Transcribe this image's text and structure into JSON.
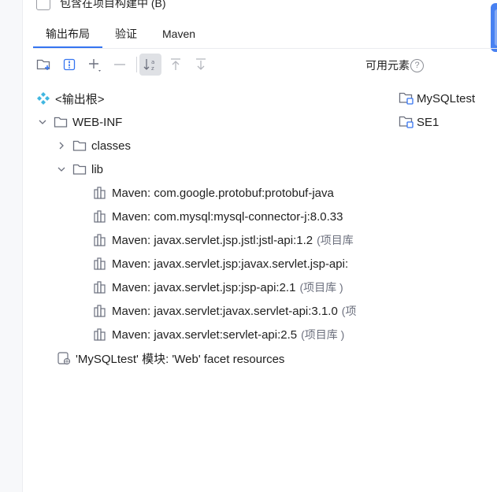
{
  "checkbox": {
    "label": "包含在项目构建中 (B)",
    "checked": false
  },
  "tabs": [
    {
      "label": "输出布局",
      "active": true
    },
    {
      "label": "验证",
      "active": false
    },
    {
      "label": "Maven",
      "active": false
    }
  ],
  "toolbar": {
    "icons": [
      "new-folder-icon",
      "archive-icon",
      "add-icon",
      "remove-icon",
      "sort-icon",
      "move-up-icon",
      "move-down-icon"
    ]
  },
  "available": {
    "label": "可用元素",
    "items": [
      {
        "label": "MySQLtest",
        "icon": "module-folder-icon"
      },
      {
        "label": "SE1",
        "icon": "module-folder-icon"
      }
    ]
  },
  "tree": {
    "root": {
      "label": "<输出根>",
      "icon": "output-root-icon"
    },
    "webinf": {
      "label": "WEB-INF",
      "icon": "folder-icon",
      "expanded": true
    },
    "classes": {
      "label": "classes",
      "icon": "folder-icon",
      "expanded": false
    },
    "lib": {
      "label": "lib",
      "icon": "folder-icon",
      "expanded": true
    },
    "libraries": [
      {
        "label": "Maven: com.google.protobuf:protobuf-java",
        "suffix": ""
      },
      {
        "label": "Maven: com.mysql:mysql-connector-j:8.0.33",
        "suffix": ""
      },
      {
        "label": "Maven: javax.servlet.jsp.jstl:jstl-api:1.2",
        "suffix": "(项目库"
      },
      {
        "label": "Maven: javax.servlet.jsp:javax.servlet.jsp-api:",
        "suffix": ""
      },
      {
        "label": "Maven: javax.servlet.jsp:jsp-api:2.1",
        "suffix": "(项目库 )"
      },
      {
        "label": "Maven: javax.servlet:javax.servlet-api:3.1.0",
        "suffix": "(项"
      },
      {
        "label": "Maven: javax.servlet:servlet-api:2.5",
        "suffix": "(项目库 )"
      }
    ],
    "facet": {
      "label": "'MySQLtest' 模块: 'Web' facet resources",
      "icon": "web-facet-icon"
    }
  }
}
